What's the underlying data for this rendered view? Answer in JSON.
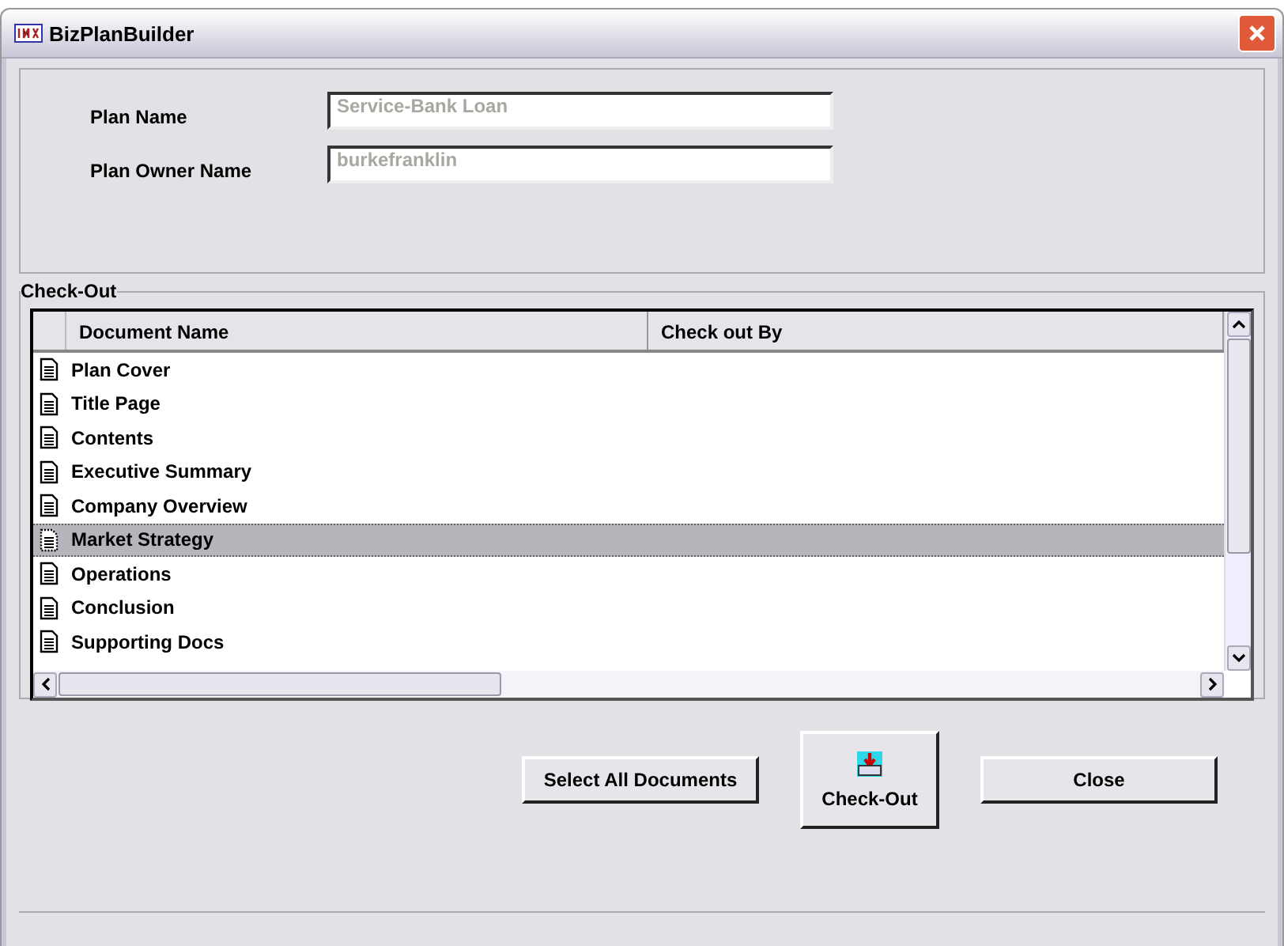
{
  "window": {
    "title": "BizPlanBuilder"
  },
  "plan_fields": [
    {
      "label": "Plan Name",
      "value": "Service-Bank Loan",
      "disabled": true
    },
    {
      "label": "Plan Owner Name",
      "value": "burkefranklin",
      "disabled": true
    }
  ],
  "checkout_group": {
    "title": "Check-Out"
  },
  "table": {
    "columns": [
      "Document Name",
      "Check out By"
    ],
    "rows": [
      {
        "name": "Plan Cover",
        "selected": false
      },
      {
        "name": "Title Page",
        "selected": false
      },
      {
        "name": "Contents",
        "selected": false
      },
      {
        "name": "Executive Summary",
        "selected": false
      },
      {
        "name": "Company Overview",
        "selected": false
      },
      {
        "name": "Market Strategy",
        "selected": true
      },
      {
        "name": "Operations",
        "selected": false
      },
      {
        "name": "Conclusion",
        "selected": false
      },
      {
        "name": "Supporting Docs",
        "selected": false
      }
    ]
  },
  "buttons": [
    {
      "kind": "text",
      "label": "Select All Documents"
    },
    {
      "kind": "icon",
      "label": "Check-Out"
    },
    {
      "kind": "text",
      "label": "Close"
    }
  ]
}
